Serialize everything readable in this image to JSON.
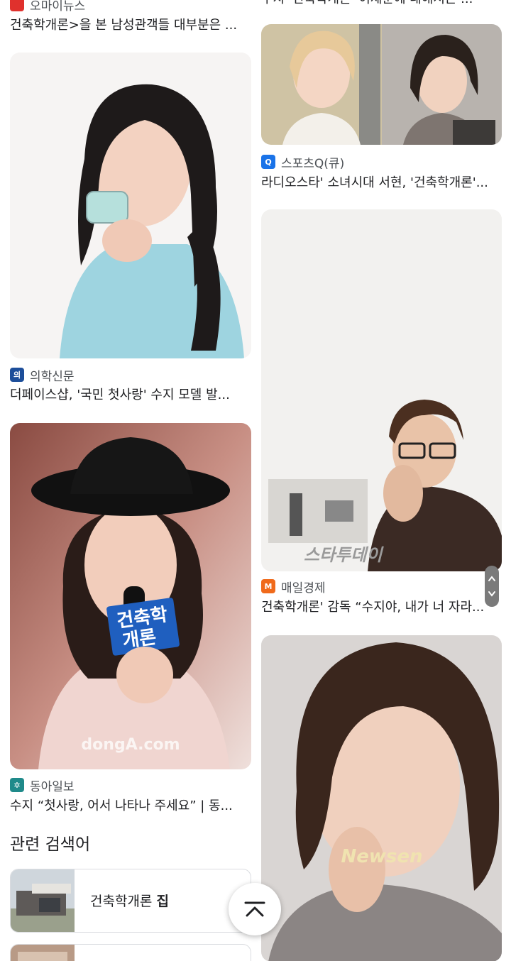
{
  "left_column": {
    "top_card": {
      "source": "오마이뉴스",
      "title": "건축학개론>을 본 남성관객들 대부분은 ..."
    },
    "cards": [
      {
        "source": "의학신문",
        "title": "더페이스샵, '국민 첫사랑' 수지 모델 발..."
      },
      {
        "source": "동아일보",
        "title": "수지 “첫사랑, 어서 나타나 주세요” | 동...",
        "image_overlay": {
          "sign": "건축학\n개론",
          "watermark": "dongA.com"
        }
      }
    ]
  },
  "right_column": {
    "top_card": {
      "title": "수지 '건축학개론' 이제훈에 대해서는 ..."
    },
    "cards": [
      {
        "source": "스포츠Q(큐)",
        "title": "라디오스타' 소녀시대 서현, '건축학개론'..."
      },
      {
        "source": "매일경제",
        "title": "건축학개론' 감독 “수지야, 내가 너 자라...",
        "image_overlay": {
          "watermark": "스타투데이"
        }
      },
      {
        "source": "",
        "title": "",
        "image_overlay": {
          "watermark": "Newsen"
        }
      }
    ]
  },
  "related": {
    "heading": "관련 검색어",
    "items": [
      {
        "label": "건축학개론",
        "bold": "집"
      },
      {
        "label": "",
        "bold": ""
      }
    ]
  },
  "colors": {
    "omynews": "#e0312d",
    "medical": "#1d4e9a",
    "donga": "#1f8a8a",
    "sportsq": "#1a73e8",
    "maeil": "#f06a1b"
  },
  "icons": {
    "scroll_top": "chevron-up-icon",
    "scroll_handle": "scroll-arrows-icon"
  }
}
